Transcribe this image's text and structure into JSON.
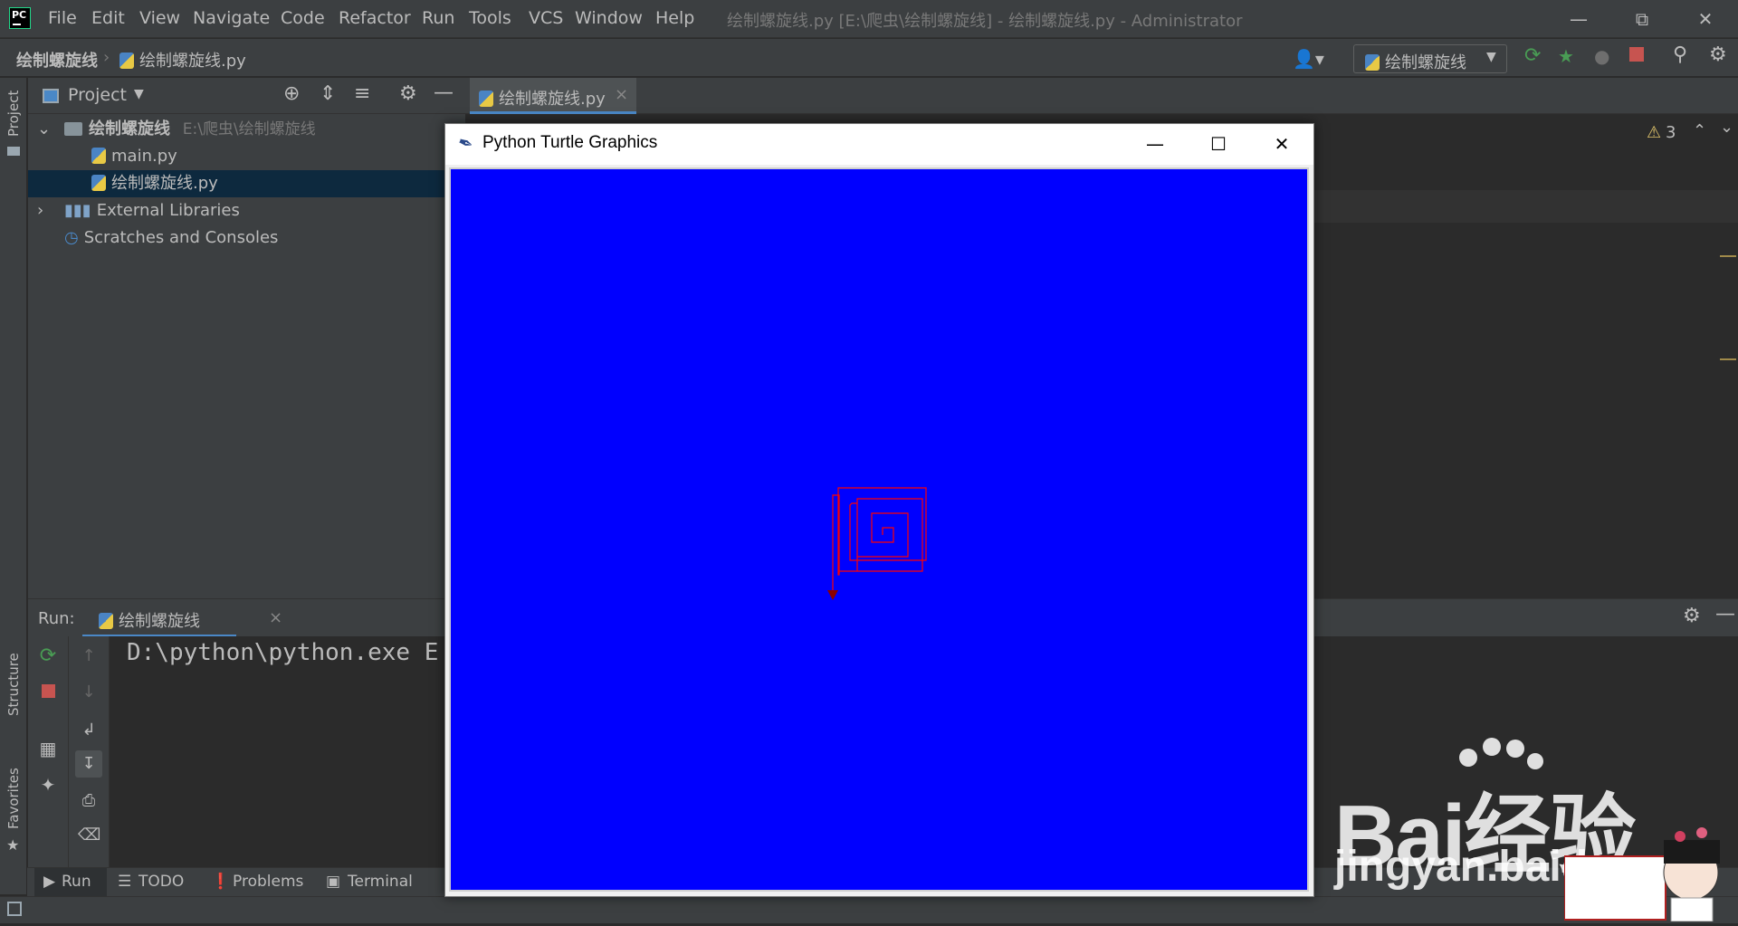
{
  "app": {
    "logo_text": "PC",
    "menu": [
      "File",
      "Edit",
      "View",
      "Navigate",
      "Code",
      "Refactor",
      "Run",
      "Tools",
      "VCS",
      "Window",
      "Help"
    ],
    "window_title": "绘制螺旋线.py [E:\\爬虫\\绘制螺旋线] - 绘制螺旋线.py - Administrator"
  },
  "breadcrumb": {
    "project": "绘制螺旋线",
    "file": "绘制螺旋线.py"
  },
  "run_config": {
    "label": "绘制螺旋线"
  },
  "left_strip": {
    "project": "Project",
    "structure": "Structure",
    "favorites": "Favorites"
  },
  "project_panel": {
    "title": "Project",
    "root_name": "绘制螺旋线",
    "root_path": "E:\\爬虫\\绘制螺旋线",
    "files": [
      "main.py",
      "绘制螺旋线.py"
    ],
    "external_libraries": "External Libraries",
    "scratches": "Scratches and Consoles"
  },
  "editor": {
    "tab_label": "绘制螺旋线.py",
    "warning_count": "3"
  },
  "run_panel": {
    "label": "Run:",
    "tab_label": "绘制螺旋线",
    "console_line": "D:\\python\\python.exe E"
  },
  "bottom_tabs": {
    "run": "Run",
    "todo": "TODO",
    "problems": "Problems",
    "terminal": "Terminal"
  },
  "turtle_window": {
    "title": "Python Turtle Graphics",
    "canvas_color": "#0000ff",
    "pen_color": "#ff0000"
  },
  "watermark": {
    "brand": "Bai经验",
    "url": "jingyan.baidu.com"
  },
  "colors": {
    "selection": "#0d293e",
    "accent": "#4a88c7",
    "run_green": "#499c54",
    "stop_red": "#c75450"
  }
}
